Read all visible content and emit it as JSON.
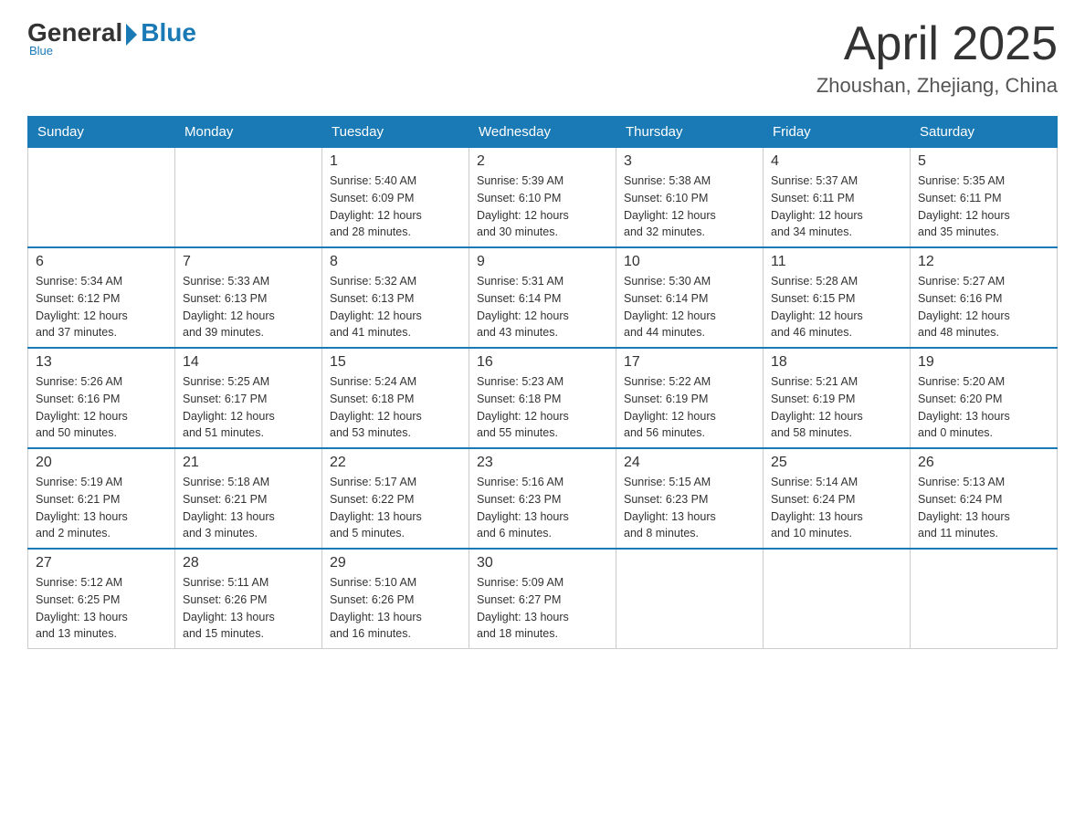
{
  "header": {
    "logo": {
      "general": "General",
      "blue": "Blue",
      "subtitle": "Blue"
    },
    "title": "April 2025",
    "location": "Zhoushan, Zhejiang, China"
  },
  "calendar": {
    "weekdays": [
      "Sunday",
      "Monday",
      "Tuesday",
      "Wednesday",
      "Thursday",
      "Friday",
      "Saturday"
    ],
    "weeks": [
      [
        {
          "day": "",
          "info": ""
        },
        {
          "day": "",
          "info": ""
        },
        {
          "day": "1",
          "info": "Sunrise: 5:40 AM\nSunset: 6:09 PM\nDaylight: 12 hours\nand 28 minutes."
        },
        {
          "day": "2",
          "info": "Sunrise: 5:39 AM\nSunset: 6:10 PM\nDaylight: 12 hours\nand 30 minutes."
        },
        {
          "day": "3",
          "info": "Sunrise: 5:38 AM\nSunset: 6:10 PM\nDaylight: 12 hours\nand 32 minutes."
        },
        {
          "day": "4",
          "info": "Sunrise: 5:37 AM\nSunset: 6:11 PM\nDaylight: 12 hours\nand 34 minutes."
        },
        {
          "day": "5",
          "info": "Sunrise: 5:35 AM\nSunset: 6:11 PM\nDaylight: 12 hours\nand 35 minutes."
        }
      ],
      [
        {
          "day": "6",
          "info": "Sunrise: 5:34 AM\nSunset: 6:12 PM\nDaylight: 12 hours\nand 37 minutes."
        },
        {
          "day": "7",
          "info": "Sunrise: 5:33 AM\nSunset: 6:13 PM\nDaylight: 12 hours\nand 39 minutes."
        },
        {
          "day": "8",
          "info": "Sunrise: 5:32 AM\nSunset: 6:13 PM\nDaylight: 12 hours\nand 41 minutes."
        },
        {
          "day": "9",
          "info": "Sunrise: 5:31 AM\nSunset: 6:14 PM\nDaylight: 12 hours\nand 43 minutes."
        },
        {
          "day": "10",
          "info": "Sunrise: 5:30 AM\nSunset: 6:14 PM\nDaylight: 12 hours\nand 44 minutes."
        },
        {
          "day": "11",
          "info": "Sunrise: 5:28 AM\nSunset: 6:15 PM\nDaylight: 12 hours\nand 46 minutes."
        },
        {
          "day": "12",
          "info": "Sunrise: 5:27 AM\nSunset: 6:16 PM\nDaylight: 12 hours\nand 48 minutes."
        }
      ],
      [
        {
          "day": "13",
          "info": "Sunrise: 5:26 AM\nSunset: 6:16 PM\nDaylight: 12 hours\nand 50 minutes."
        },
        {
          "day": "14",
          "info": "Sunrise: 5:25 AM\nSunset: 6:17 PM\nDaylight: 12 hours\nand 51 minutes."
        },
        {
          "day": "15",
          "info": "Sunrise: 5:24 AM\nSunset: 6:18 PM\nDaylight: 12 hours\nand 53 minutes."
        },
        {
          "day": "16",
          "info": "Sunrise: 5:23 AM\nSunset: 6:18 PM\nDaylight: 12 hours\nand 55 minutes."
        },
        {
          "day": "17",
          "info": "Sunrise: 5:22 AM\nSunset: 6:19 PM\nDaylight: 12 hours\nand 56 minutes."
        },
        {
          "day": "18",
          "info": "Sunrise: 5:21 AM\nSunset: 6:19 PM\nDaylight: 12 hours\nand 58 minutes."
        },
        {
          "day": "19",
          "info": "Sunrise: 5:20 AM\nSunset: 6:20 PM\nDaylight: 13 hours\nand 0 minutes."
        }
      ],
      [
        {
          "day": "20",
          "info": "Sunrise: 5:19 AM\nSunset: 6:21 PM\nDaylight: 13 hours\nand 2 minutes."
        },
        {
          "day": "21",
          "info": "Sunrise: 5:18 AM\nSunset: 6:21 PM\nDaylight: 13 hours\nand 3 minutes."
        },
        {
          "day": "22",
          "info": "Sunrise: 5:17 AM\nSunset: 6:22 PM\nDaylight: 13 hours\nand 5 minutes."
        },
        {
          "day": "23",
          "info": "Sunrise: 5:16 AM\nSunset: 6:23 PM\nDaylight: 13 hours\nand 6 minutes."
        },
        {
          "day": "24",
          "info": "Sunrise: 5:15 AM\nSunset: 6:23 PM\nDaylight: 13 hours\nand 8 minutes."
        },
        {
          "day": "25",
          "info": "Sunrise: 5:14 AM\nSunset: 6:24 PM\nDaylight: 13 hours\nand 10 minutes."
        },
        {
          "day": "26",
          "info": "Sunrise: 5:13 AM\nSunset: 6:24 PM\nDaylight: 13 hours\nand 11 minutes."
        }
      ],
      [
        {
          "day": "27",
          "info": "Sunrise: 5:12 AM\nSunset: 6:25 PM\nDaylight: 13 hours\nand 13 minutes."
        },
        {
          "day": "28",
          "info": "Sunrise: 5:11 AM\nSunset: 6:26 PM\nDaylight: 13 hours\nand 15 minutes."
        },
        {
          "day": "29",
          "info": "Sunrise: 5:10 AM\nSunset: 6:26 PM\nDaylight: 13 hours\nand 16 minutes."
        },
        {
          "day": "30",
          "info": "Sunrise: 5:09 AM\nSunset: 6:27 PM\nDaylight: 13 hours\nand 18 minutes."
        },
        {
          "day": "",
          "info": ""
        },
        {
          "day": "",
          "info": ""
        },
        {
          "day": "",
          "info": ""
        }
      ]
    ]
  }
}
